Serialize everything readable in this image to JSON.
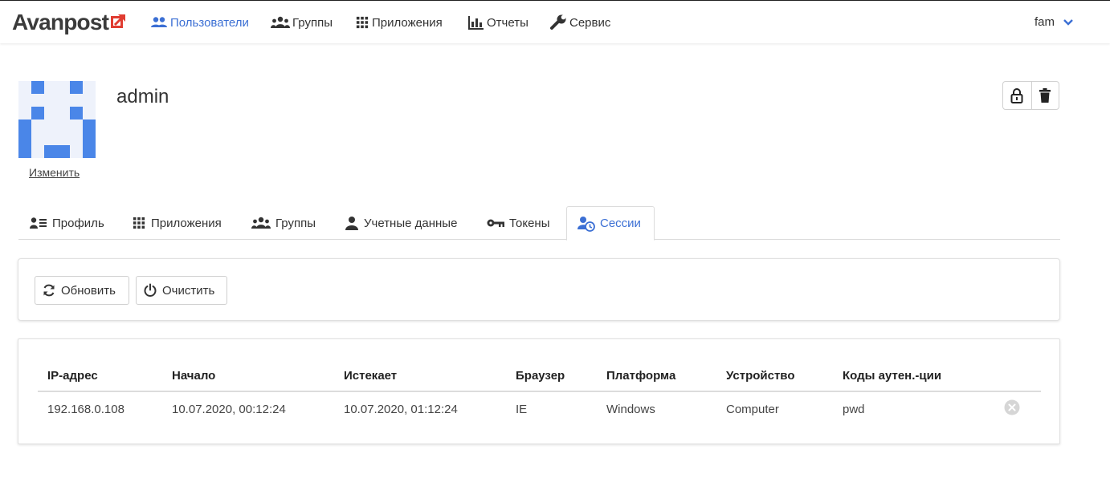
{
  "brand": {
    "name": "Avanpost"
  },
  "nav": {
    "items": [
      {
        "label": "Пользователи",
        "icon": "users-icon"
      },
      {
        "label": "Группы",
        "icon": "group-icon"
      },
      {
        "label": "Приложения",
        "icon": "apps-grid-icon"
      },
      {
        "label": "Отчеты",
        "icon": "bar-chart-icon"
      },
      {
        "label": "Сервис",
        "icon": "wrench-icon"
      }
    ],
    "active": "Пользователи",
    "user": "fam"
  },
  "profile": {
    "name": "admin",
    "change_avatar": "Изменить"
  },
  "tabs": [
    {
      "label": "Профиль",
      "icon": "profile-card-icon"
    },
    {
      "label": "Приложения",
      "icon": "apps-grid-icon"
    },
    {
      "label": "Группы",
      "icon": "group-icon"
    },
    {
      "label": "Учетные данные",
      "icon": "user-icon"
    },
    {
      "label": "Токены",
      "icon": "key-icon"
    },
    {
      "label": "Сессии",
      "icon": "user-clock-icon"
    }
  ],
  "active_tab": "Сессии",
  "actions": {
    "refresh": "Обновить",
    "clear": "Очистить"
  },
  "sessions": {
    "columns": [
      "IP-адрес",
      "Начало",
      "Истекает",
      "Браузер",
      "Платформа",
      "Устройство",
      "Коды аутен.-ции"
    ],
    "rows": [
      [
        "192.168.0.108",
        "10.07.2020, 00:12:24",
        "10.07.2020, 01:12:24",
        "IE",
        "Windows",
        "Computer",
        "pwd"
      ]
    ]
  },
  "colors": {
    "accent": "#3b6fd4",
    "avatar_fill": "#4a86e8",
    "avatar_bg": "#eef2fb",
    "logo_arrow": "#e03c31"
  }
}
